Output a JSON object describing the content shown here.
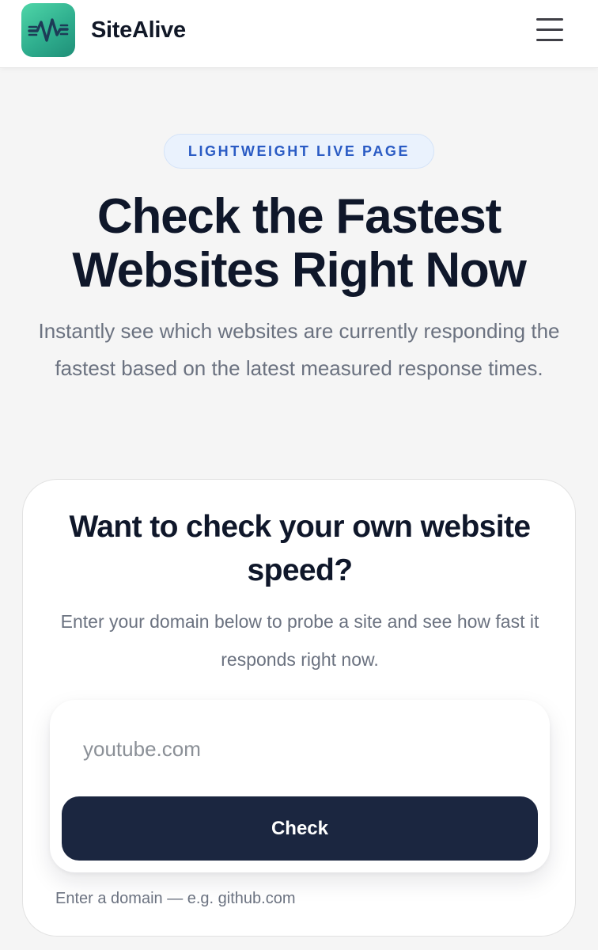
{
  "header": {
    "brand": "SiteAlive",
    "logo_icon": "pulse-wave-icon",
    "menu_icon": "hamburger-menu-icon",
    "logo_color": "#2fae8e"
  },
  "hero": {
    "badge": "LIGHTWEIGHT LIVE PAGE",
    "title": "Check the Fastest Websites Right Now",
    "subtitle": "Instantly see which websites are currently responding the fastest based on the latest measured response times."
  },
  "check_card": {
    "title": "Want to check your own website speed?",
    "subtitle": "Enter your domain below to probe a site and see how fast it responds right now.",
    "input_placeholder": "youtube.com",
    "input_value": "",
    "button_label": "Check",
    "hint": "Enter a domain — e.g. github.com",
    "button_color": "#1b2640"
  }
}
